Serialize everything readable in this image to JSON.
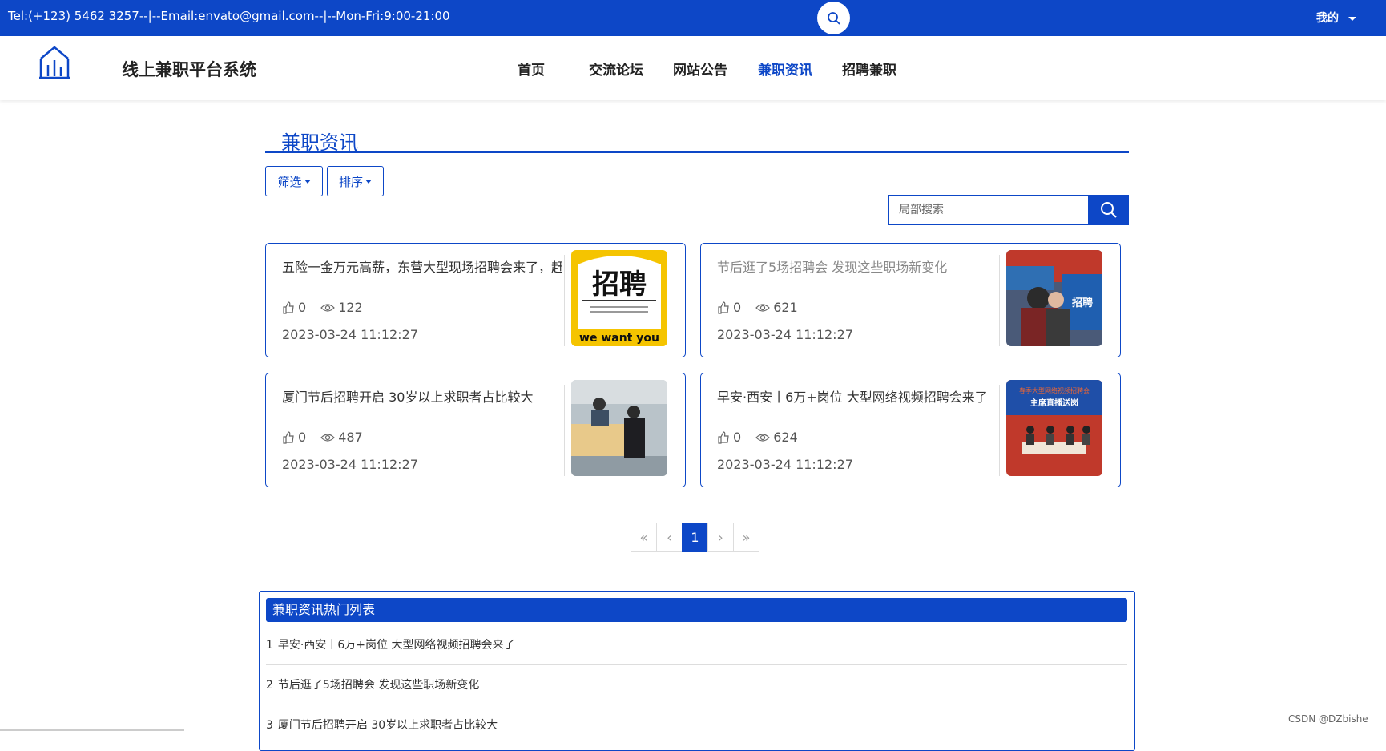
{
  "topbar": {
    "contact": "Tel:(+123) 5462 3257--|--Email:envato@gmail.com--|--Mon-Fri:9:00-21:00",
    "mine_label": "我的"
  },
  "navbar": {
    "site_title": "线上兼职平台系统",
    "items": [
      {
        "label": "首页"
      },
      {
        "label": "交流论坛"
      },
      {
        "label": "网站公告"
      },
      {
        "label": "兼职资讯"
      },
      {
        "label": "招聘兼职"
      }
    ],
    "active": "兼职资讯"
  },
  "section": {
    "title": "兼职资讯",
    "filter_label": "筛选",
    "sort_label": "排序",
    "search_placeholder": "局部搜索"
  },
  "cards": [
    {
      "title": "五险一金万元高薪，东营大型现场招聘会来了，赶",
      "likes": "0",
      "views": "122",
      "date": "2023-03-24 11:12:27",
      "image": "recruit-poster-yellow"
    },
    {
      "title": "节后逛了5场招聘会 发现这些职场新变化",
      "likes": "0",
      "views": "621",
      "date": "2023-03-24 11:12:27",
      "image": "job-fair-photo"
    },
    {
      "title": "厦门节后招聘开启 30岁以上求职者占比较大",
      "likes": "0",
      "views": "487",
      "date": "2023-03-24 11:12:27",
      "image": "interview-desk-photo"
    },
    {
      "title": "早安·西安丨6万+岗位 大型网络视频招聘会来了",
      "likes": "0",
      "views": "624",
      "date": "2023-03-24 11:12:27",
      "image": "livestream-stage-photo"
    }
  ],
  "thumb_text": {
    "poster_big": "招聘",
    "poster_tag": "we want you",
    "fair_sign": "招聘",
    "stage_banner_1": "春季大型网络视频招聘会",
    "stage_banner_2": "主席直播送岗"
  },
  "pagination": {
    "first": "«",
    "prev": "‹",
    "current": "1",
    "next": "›",
    "last": "»"
  },
  "hot_list": {
    "title": "兼职资讯热门列表",
    "items": [
      {
        "num": "1",
        "text": "早安·西安丨6万+岗位 大型网络视频招聘会来了"
      },
      {
        "num": "2",
        "text": "节后逛了5场招聘会 发现这些职场新变化"
      },
      {
        "num": "3",
        "text": "厦门节后招聘开启 30岁以上求职者占比较大"
      }
    ]
  },
  "watermark": "CSDN @DZbishe",
  "colors": {
    "primary": "#0d47c7",
    "text": "#333333",
    "muted": "#888888"
  }
}
